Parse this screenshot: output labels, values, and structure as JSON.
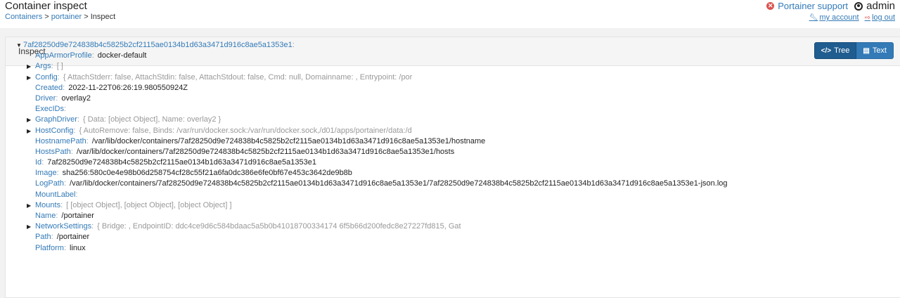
{
  "header": {
    "title": "Container inspect",
    "breadcrumb": {
      "containers": "Containers",
      "sep1": ">",
      "portainer": "portainer",
      "sep2": ">",
      "current": "Inspect"
    },
    "support_label": "Portainer support",
    "user_label": "admin",
    "my_account": "my account",
    "log_out": "log out"
  },
  "panel": {
    "title": "Inspect",
    "tree_button": "Tree",
    "text_button": "Text"
  },
  "tree": {
    "root_key": "7af28250d9e724838b4c5825b2cf2115ae0134b1d63a3471d916c8ae5a1353e1",
    "rows": [
      {
        "key": "AppArmorProfile",
        "value": "docker-default",
        "expandable": false
      },
      {
        "key": "Args",
        "value": "[ ]",
        "expandable": true
      },
      {
        "key": "Config",
        "value": "{ AttachStderr: false, AttachStdin: false, AttachStdout: false, Cmd: null, Domainname: , Entrypoint: /por",
        "expandable": true
      },
      {
        "key": "Created",
        "value": "2022-11-22T06:26:19.980550924Z",
        "expandable": false
      },
      {
        "key": "Driver",
        "value": "overlay2",
        "expandable": false
      },
      {
        "key": "ExecIDs",
        "value": "",
        "expandable": false
      },
      {
        "key": "GraphDriver",
        "value": "{ Data: [object Object], Name: overlay2 }",
        "expandable": true
      },
      {
        "key": "HostConfig",
        "value": "{ AutoRemove: false, Binds: /var/run/docker.sock:/var/run/docker.sock,/d01/apps/portainer/data:/d",
        "expandable": true
      },
      {
        "key": "HostnamePath",
        "value": "/var/lib/docker/containers/7af28250d9e724838b4c5825b2cf2115ae0134b1d63a3471d916c8ae5a1353e1/hostname",
        "expandable": false
      },
      {
        "key": "HostsPath",
        "value": "/var/lib/docker/containers/7af28250d9e724838b4c5825b2cf2115ae0134b1d63a3471d916c8ae5a1353e1/hosts",
        "expandable": false
      },
      {
        "key": "Id",
        "value": "7af28250d9e724838b4c5825b2cf2115ae0134b1d63a3471d916c8ae5a1353e1",
        "expandable": false
      },
      {
        "key": "Image",
        "value": "sha256:580c0e4e98b06d258754cf28c55f21a6fa0dc386e6fe0bf67e453c3642de9b8b",
        "expandable": false
      },
      {
        "key": "LogPath",
        "value": "/var/lib/docker/containers/7af28250d9e724838b4c5825b2cf2115ae0134b1d63a3471d916c8ae5a1353e1/7af28250d9e724838b4c5825b2cf2115ae0134b1d63a3471d916c8ae5a1353e1-json.log",
        "expandable": false
      },
      {
        "key": "MountLabel",
        "value": "",
        "expandable": false
      },
      {
        "key": "Mounts",
        "value": "[ [object Object], [object Object], [object Object] ]",
        "expandable": true
      },
      {
        "key": "Name",
        "value": "/portainer",
        "expandable": false
      },
      {
        "key": "NetworkSettings",
        "value": "{ Bridge: , EndpointID: ddc4ce9d6c584bdaac5a5b0b41018700334174 6f5b66d200fedc8e27227fd815, Gat",
        "expandable": true
      },
      {
        "key": "Path",
        "value": "/portainer",
        "expandable": false
      },
      {
        "key": "Platform",
        "value": "linux",
        "expandable": false
      }
    ]
  }
}
